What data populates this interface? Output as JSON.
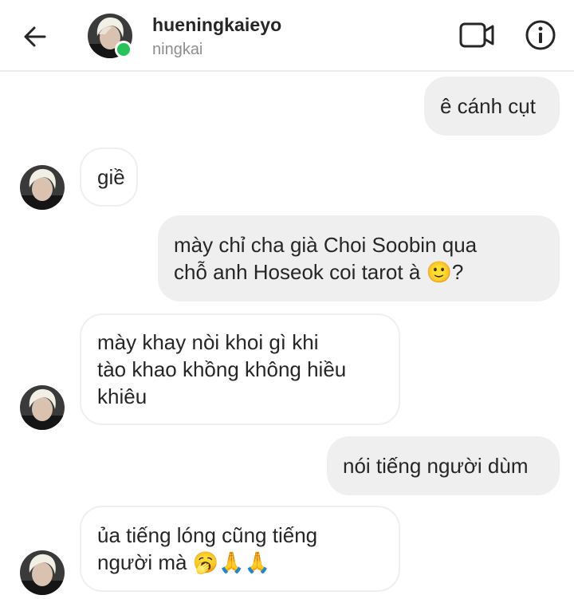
{
  "header": {
    "username": "hueningkaieyo",
    "subtitle": "ningkai",
    "back_icon": "arrow-left-icon",
    "video_icon": "video-camera-icon",
    "info_icon": "info-icon",
    "online_color": "#27c35a"
  },
  "messages": [
    {
      "direction": "outgoing",
      "text": "ê cánh cụt"
    },
    {
      "direction": "incoming",
      "text": "giề"
    },
    {
      "direction": "outgoing",
      "text": "mày chỉ cha già Choi Soobin qua\nchỗ anh Hoseok coi tarot à 🙂?"
    },
    {
      "direction": "incoming",
      "text": "mày khay nòi khoi gì khi\ntào khao khồng không hiều\nkhiêu"
    },
    {
      "direction": "outgoing",
      "text": "nói tiếng người dùm"
    },
    {
      "direction": "incoming",
      "text": "ủa tiếng lóng cũng tiếng\nngười mà 🥱🙏🙏"
    }
  ],
  "colors": {
    "outgoing_bubble": "#efefef",
    "incoming_border": "#efefef",
    "text": "#262626",
    "muted": "#8e8e8e"
  }
}
